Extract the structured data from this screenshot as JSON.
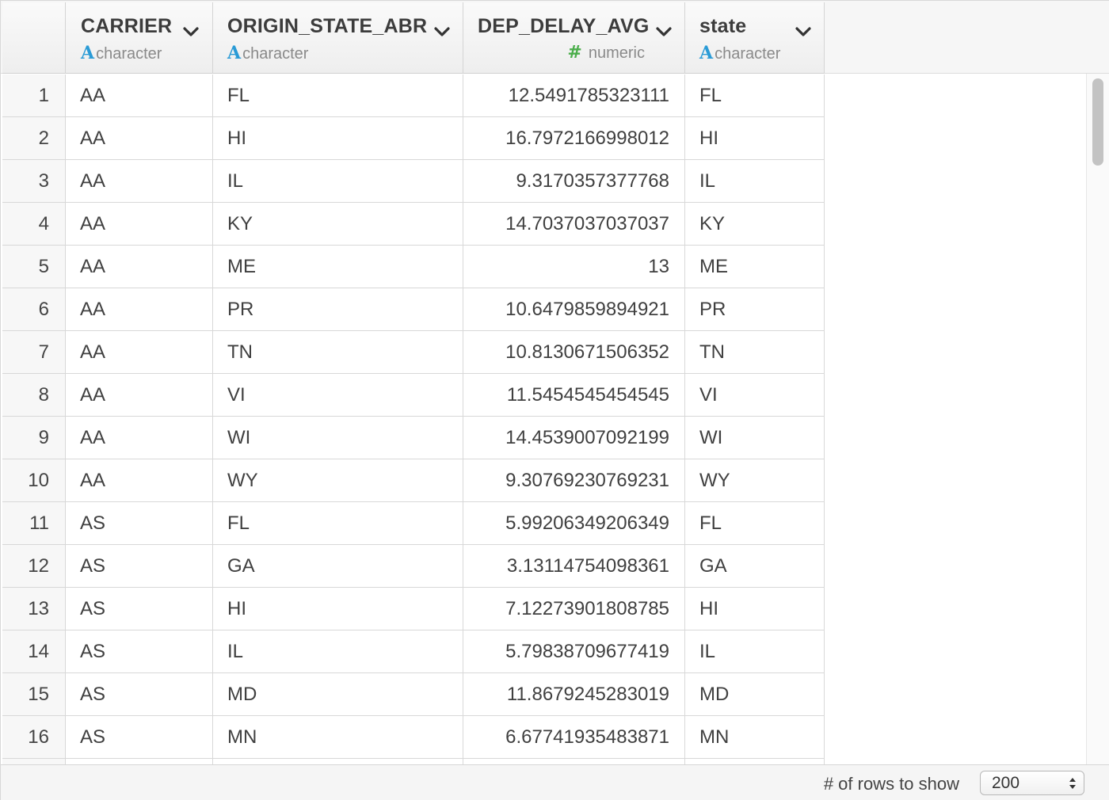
{
  "columns": [
    {
      "name": "CARRIER",
      "type": "character",
      "type_icon": "A"
    },
    {
      "name": "ORIGIN_STATE_ABR",
      "type": "character",
      "type_icon": "A"
    },
    {
      "name": "DEP_DELAY_AVG",
      "type": "numeric",
      "type_icon": "#"
    },
    {
      "name": "state",
      "type": "character",
      "type_icon": "A"
    }
  ],
  "rows": [
    {
      "idx": "1",
      "carrier": "AA",
      "origin": "FL",
      "delay": "12.5491785323111",
      "state": "FL"
    },
    {
      "idx": "2",
      "carrier": "AA",
      "origin": "HI",
      "delay": "16.7972166998012",
      "state": "HI"
    },
    {
      "idx": "3",
      "carrier": "AA",
      "origin": "IL",
      "delay": "9.3170357377768",
      "state": "IL"
    },
    {
      "idx": "4",
      "carrier": "AA",
      "origin": "KY",
      "delay": "14.7037037037037",
      "state": "KY"
    },
    {
      "idx": "5",
      "carrier": "AA",
      "origin": "ME",
      "delay": "13",
      "state": "ME"
    },
    {
      "idx": "6",
      "carrier": "AA",
      "origin": "PR",
      "delay": "10.6479859894921",
      "state": "PR"
    },
    {
      "idx": "7",
      "carrier": "AA",
      "origin": "TN",
      "delay": "10.8130671506352",
      "state": "TN"
    },
    {
      "idx": "8",
      "carrier": "AA",
      "origin": "VI",
      "delay": "11.5454545454545",
      "state": "VI"
    },
    {
      "idx": "9",
      "carrier": "AA",
      "origin": "WI",
      "delay": "14.4539007092199",
      "state": "WI"
    },
    {
      "idx": "10",
      "carrier": "AA",
      "origin": "WY",
      "delay": "9.30769230769231",
      "state": "WY"
    },
    {
      "idx": "11",
      "carrier": "AS",
      "origin": "FL",
      "delay": "5.99206349206349",
      "state": "FL"
    },
    {
      "idx": "12",
      "carrier": "AS",
      "origin": "GA",
      "delay": "3.13114754098361",
      "state": "GA"
    },
    {
      "idx": "13",
      "carrier": "AS",
      "origin": "HI",
      "delay": "7.12273901808785",
      "state": "HI"
    },
    {
      "idx": "14",
      "carrier": "AS",
      "origin": "IL",
      "delay": "5.79838709677419",
      "state": "IL"
    },
    {
      "idx": "15",
      "carrier": "AS",
      "origin": "MD",
      "delay": "11.8679245283019",
      "state": "MD"
    },
    {
      "idx": "16",
      "carrier": "AS",
      "origin": "MN",
      "delay": "6.67741935483871",
      "state": "MN"
    }
  ],
  "footer": {
    "rows_label": "# of rows to show",
    "rows_value": "200"
  },
  "colors": {
    "character_icon": "#2a9bd6",
    "numeric_icon": "#4cae4c"
  }
}
